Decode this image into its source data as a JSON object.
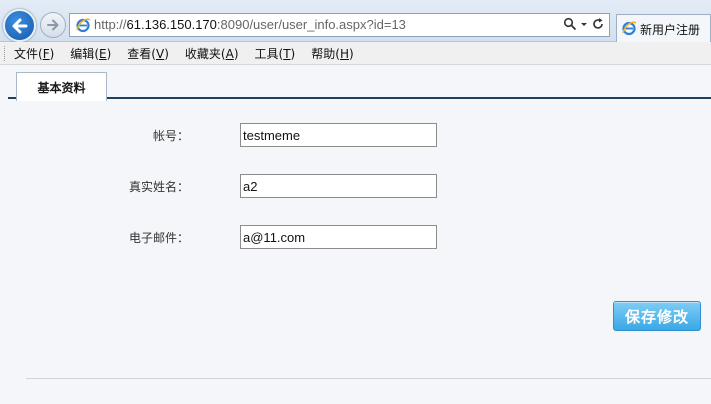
{
  "browser": {
    "url_prefix": "http://",
    "url_host": "61.136.150.170",
    "url_rest": ":8090/user/user_info.aspx?id=13",
    "tab_title": "新用户注册"
  },
  "menu": [
    {
      "label": "文件",
      "key": "F"
    },
    {
      "label": "编辑",
      "key": "E"
    },
    {
      "label": "查看",
      "key": "V"
    },
    {
      "label": "收藏夹",
      "key": "A"
    },
    {
      "label": "工具",
      "key": "T"
    },
    {
      "label": "帮助",
      "key": "H"
    }
  ],
  "page": {
    "tab_label": "基本资料",
    "fields": {
      "account": {
        "label": "帐号：",
        "value": "testmeme"
      },
      "real_name": {
        "label": "真实姓名：",
        "value": "a2"
      },
      "email": {
        "label": "电子邮件：",
        "value": "a@11.com"
      }
    },
    "save_label": "保存修改"
  },
  "colors": {
    "accent": "#3aa8e6",
    "tab_underline": "#1f3f5e",
    "back_button": "#1559ad"
  },
  "icons": [
    "back-arrow-icon",
    "forward-arrow-icon",
    "ie-icon",
    "search-icon",
    "dropdown-icon",
    "refresh-icon"
  ]
}
